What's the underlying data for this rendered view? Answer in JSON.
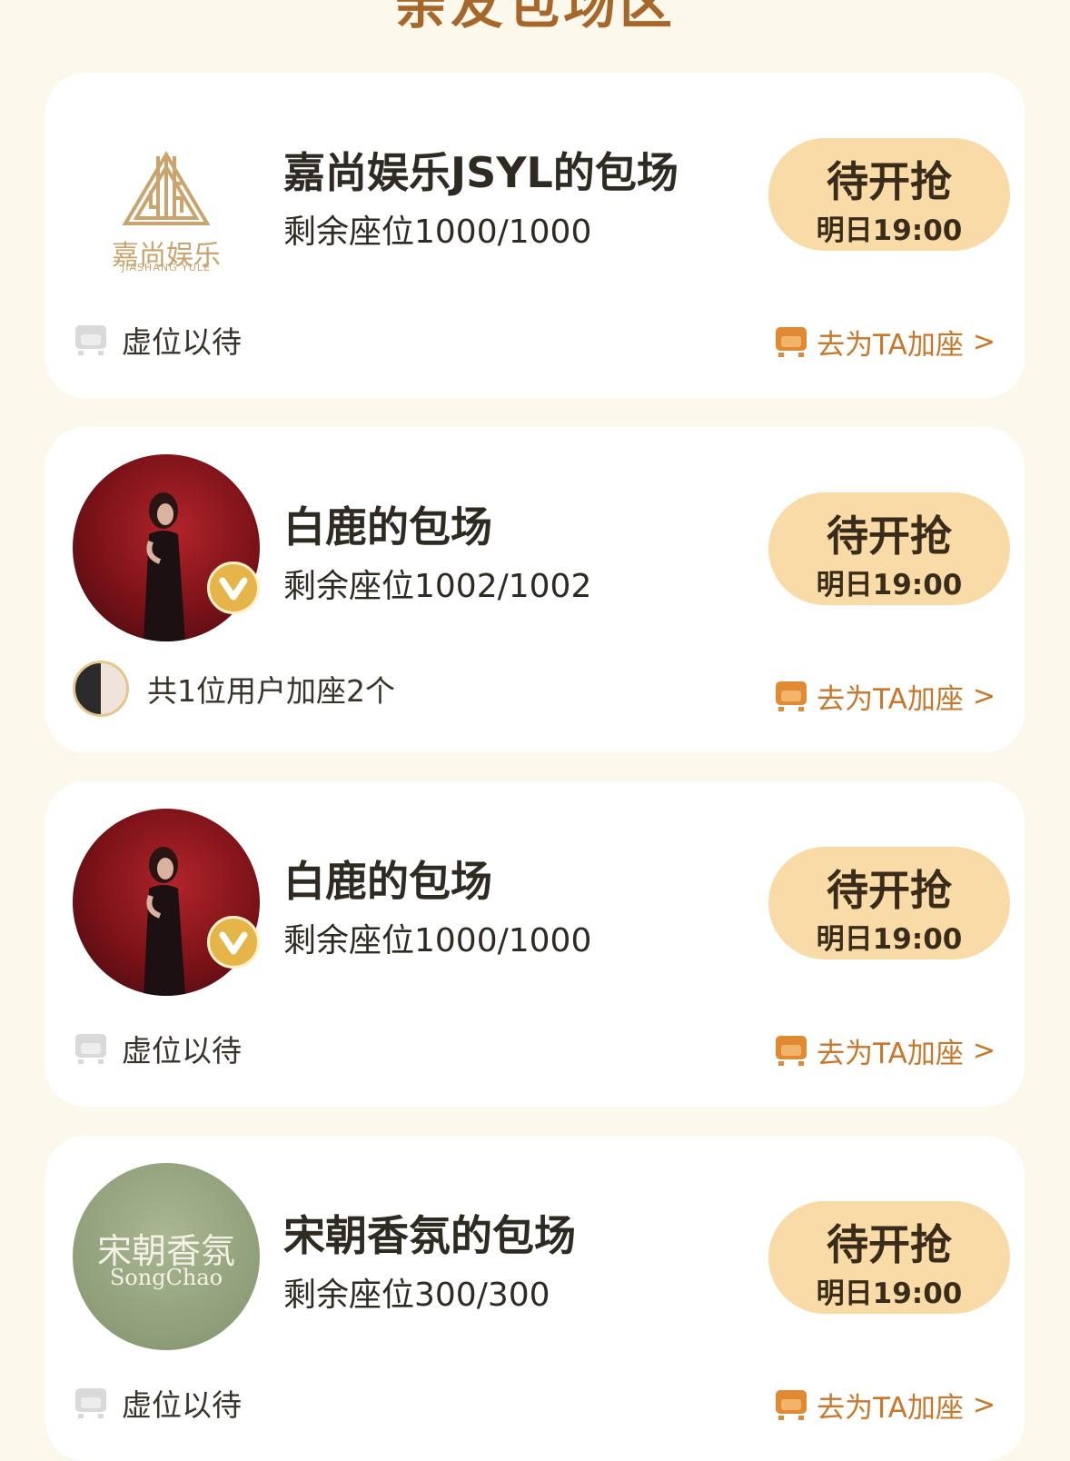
{
  "section": {
    "title": "亲友包场区"
  },
  "cards": [
    {
      "name": "嘉尚娱乐JSYL的包场",
      "seats": "剩余座位1000/1000",
      "button": {
        "main": "待开抢",
        "sub": "明日19:00"
      },
      "footer": "虚位以待",
      "add_label": "去为TA加座",
      "chevron": ">",
      "logo": {
        "cn": "嘉尚娱乐",
        "en": "JIASHANG YULE"
      }
    },
    {
      "name": "白鹿的包场",
      "seats": "剩余座位1002/1002",
      "button": {
        "main": "待开抢",
        "sub": "明日19:00"
      },
      "footer": "共1位用户加座2个",
      "add_label": "去为TA加座",
      "chevron": ">"
    },
    {
      "name": "白鹿的包场",
      "seats": "剩余座位1000/1000",
      "button": {
        "main": "待开抢",
        "sub": "明日19:00"
      },
      "footer": "虚位以待",
      "add_label": "去为TA加座",
      "chevron": ">"
    },
    {
      "name": "宋朝香氛的包场",
      "seats": "剩余座位300/300",
      "button": {
        "main": "待开抢",
        "sub": "明日19:00"
      },
      "footer": "虚位以待",
      "add_label": "去为TA加座",
      "chevron": ">",
      "logo": {
        "cn": "宋朝香氛",
        "en": "SongChao"
      }
    }
  ],
  "colors": {
    "background": "#fdf8ec",
    "accent": "#c9772a",
    "button": "#f8dba6",
    "title": "#a7672a"
  },
  "icons": {
    "empty_seat": "grey-armchair-icon",
    "add_seat": "orange-armchair-icon",
    "verified": "verified-v-badge-icon"
  }
}
